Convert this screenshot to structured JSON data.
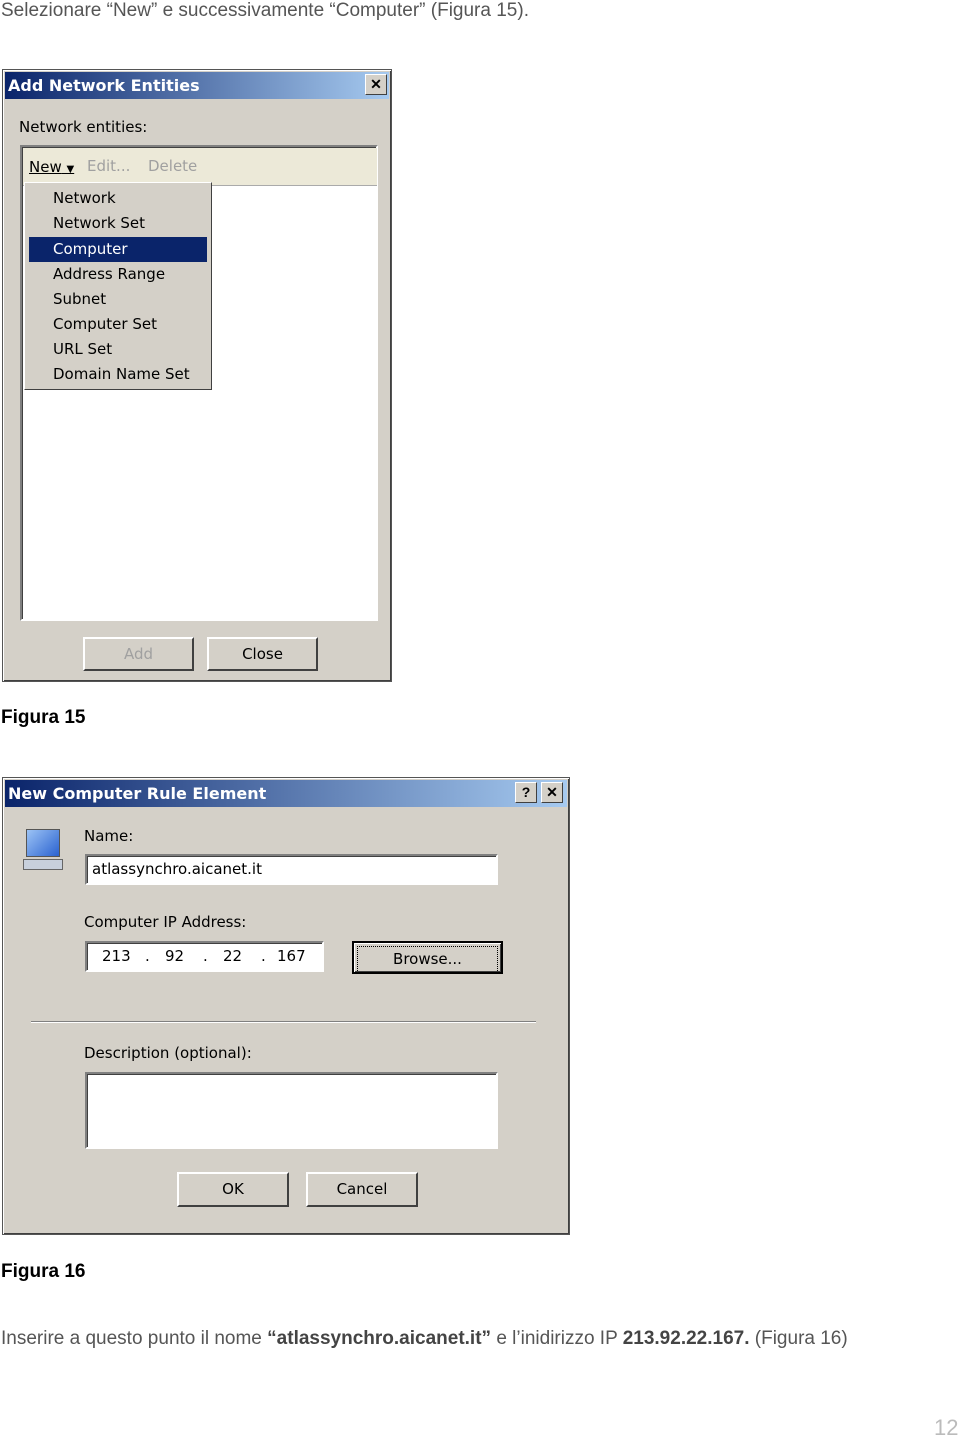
{
  "intro": "Selezionare “New” e successivamente “Computer” (Figura 15).",
  "dialog1": {
    "title": "Add Network Entities",
    "label": "Network entities:",
    "toolbar": {
      "new": "New",
      "edit": "Edit...",
      "delete": "Delete"
    },
    "menu": [
      "Network",
      "Network Set",
      "Computer",
      "Address Range",
      "Subnet",
      "Computer Set",
      "URL Set",
      "Domain Name Set"
    ],
    "selected": "Computer",
    "add": "Add",
    "close": "Close"
  },
  "caption1": "Figura 15",
  "dialog2": {
    "title": "New Computer Rule Element",
    "help": "?",
    "close_x": "✕",
    "name_label": "Name:",
    "name_value": "atlassynchro.aicanet.it",
    "ip_label": "Computer IP Address:",
    "ip": [
      "213",
      "92",
      "22",
      "167"
    ],
    "browse": "Browse...",
    "desc_label": "Description (optional):",
    "desc_value": "",
    "ok": "OK",
    "cancel": "Cancel"
  },
  "caption2": "Figura 16",
  "outro": {
    "p1": "Inserire a questo punto il nome ",
    "b1": "“atlassynchro.aicanet.it”",
    "p2": " e l’inidirizzo IP ",
    "b2": "213.92.22.167.",
    "p3": " (Figura 16)"
  },
  "page_number": "12"
}
